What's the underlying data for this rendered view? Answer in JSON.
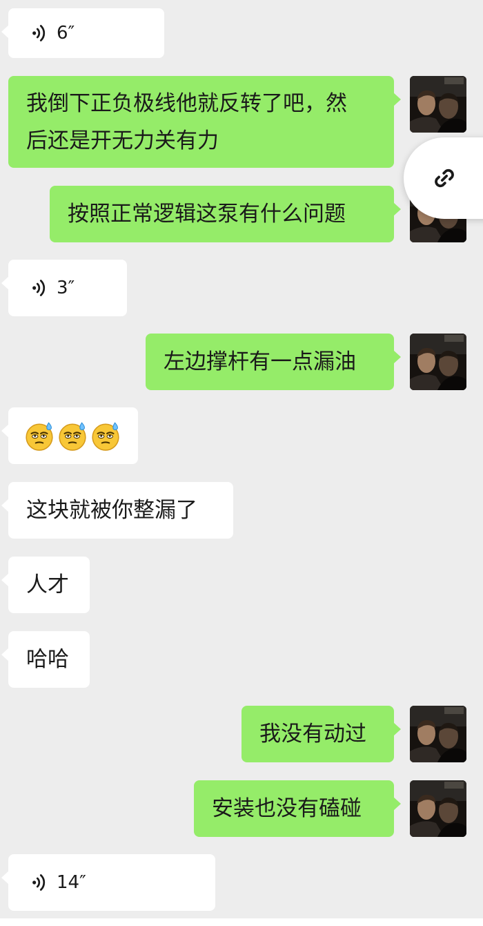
{
  "messages": [
    {
      "id": 1,
      "side": "in",
      "type": "voice",
      "duration": "6″"
    },
    {
      "id": 2,
      "side": "out",
      "type": "text",
      "lines": [
        "我倒下正负极线他就反转了吧，然",
        "后还是开无力关有力"
      ]
    },
    {
      "id": 3,
      "side": "out",
      "type": "text",
      "text": "按照正常逻辑这泵有什么问题"
    },
    {
      "id": 4,
      "side": "in",
      "type": "voice",
      "duration": "3″"
    },
    {
      "id": 5,
      "side": "out",
      "type": "text",
      "text": "左边撑杆有一点漏油"
    },
    {
      "id": 6,
      "side": "in",
      "type": "emoji",
      "emoji": [
        "sweat-face-emoji",
        "sweat-face-emoji",
        "sweat-face-emoji"
      ]
    },
    {
      "id": 7,
      "side": "in",
      "type": "text",
      "text": "这块就被你整漏了"
    },
    {
      "id": 8,
      "side": "in",
      "type": "text",
      "text": "人才"
    },
    {
      "id": 9,
      "side": "in",
      "type": "text",
      "text": "哈哈"
    },
    {
      "id": 10,
      "side": "out",
      "type": "text",
      "text": "我没有动过"
    },
    {
      "id": 11,
      "side": "out",
      "type": "text",
      "text": "安装也没有磕碰"
    },
    {
      "id": 12,
      "side": "in",
      "type": "voice",
      "duration": "14″"
    }
  ],
  "floating": {
    "icon": "link-icon"
  },
  "colors": {
    "background": "#ededed",
    "incoming_bubble": "#ffffff",
    "outgoing_bubble": "#95ec69",
    "text": "#1a1a1a"
  }
}
